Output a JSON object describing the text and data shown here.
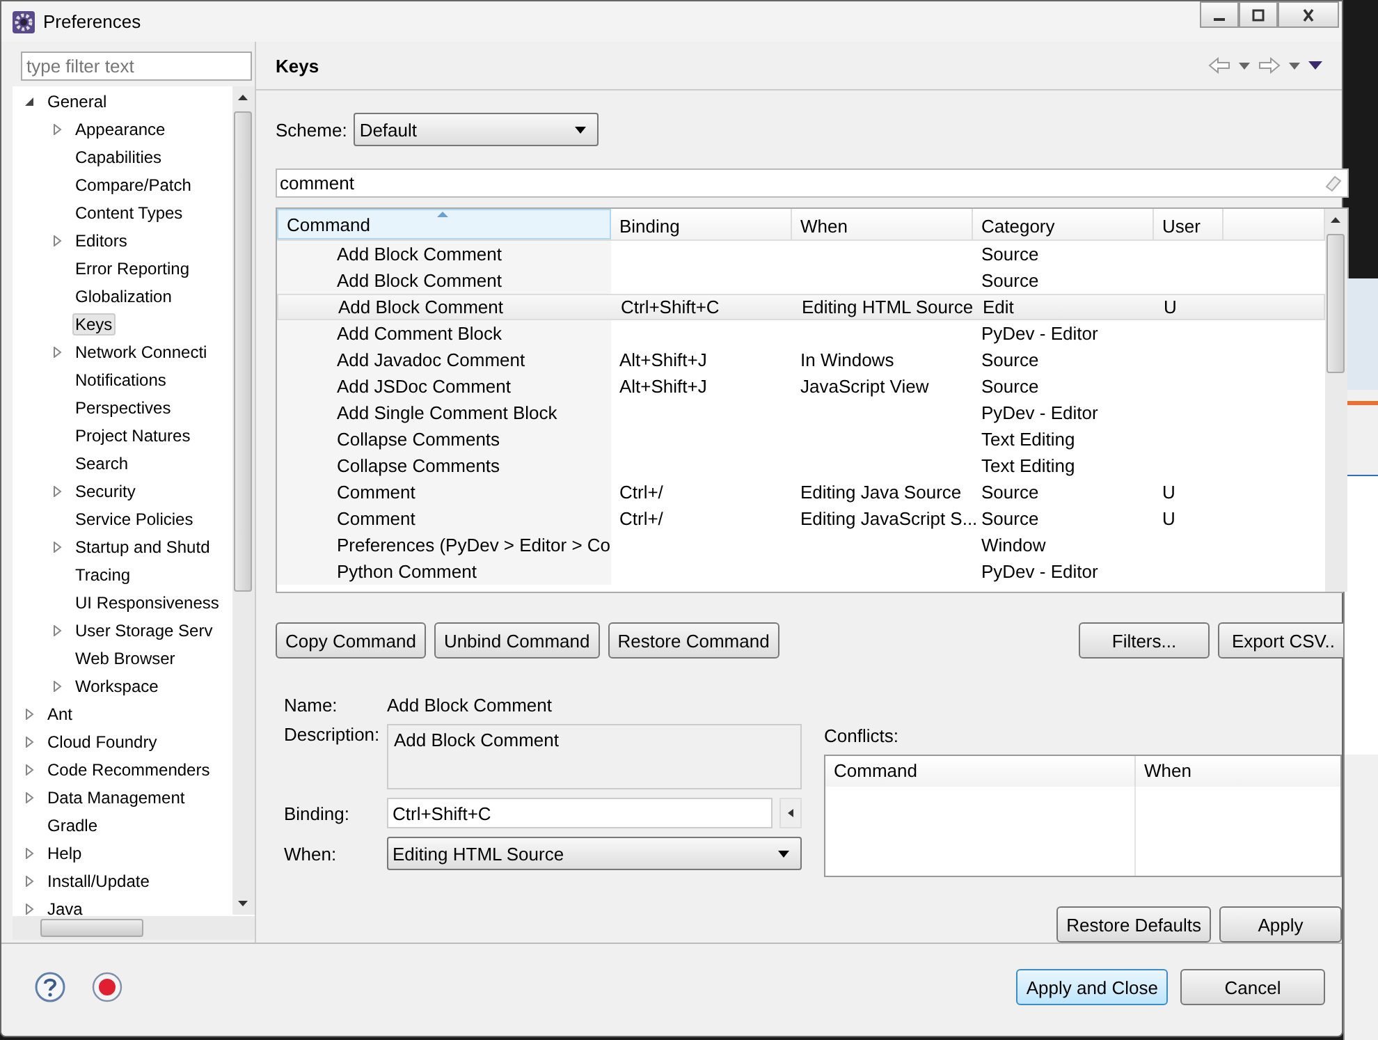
{
  "window": {
    "title": "Preferences"
  },
  "sidebar": {
    "filter": {
      "placeholder": "type filter text"
    },
    "tree": [
      {
        "label": "General",
        "expanded": true,
        "selected": false,
        "children": [
          {
            "label": "Appearance",
            "expanded": false,
            "selected": false
          },
          {
            "label": "Capabilities",
            "selected": false
          },
          {
            "label": "Compare/Patch",
            "selected": false
          },
          {
            "label": "Content Types",
            "selected": false
          },
          {
            "label": "Editors",
            "expanded": false,
            "selected": false
          },
          {
            "label": "Error Reporting",
            "selected": false
          },
          {
            "label": "Globalization",
            "selected": false
          },
          {
            "label": "Keys",
            "selected": true
          },
          {
            "label": "Network Connecti",
            "expanded": false,
            "selected": false
          },
          {
            "label": "Notifications",
            "selected": false
          },
          {
            "label": "Perspectives",
            "selected": false
          },
          {
            "label": "Project Natures",
            "selected": false
          },
          {
            "label": "Search",
            "selected": false
          },
          {
            "label": "Security",
            "expanded": false,
            "selected": false
          },
          {
            "label": "Service Policies",
            "selected": false
          },
          {
            "label": "Startup and Shutd",
            "expanded": false,
            "selected": false
          },
          {
            "label": "Tracing",
            "selected": false
          },
          {
            "label": "UI Responsiveness",
            "selected": false
          },
          {
            "label": "User Storage Serv",
            "expanded": false,
            "selected": false
          },
          {
            "label": "Web Browser",
            "selected": false
          },
          {
            "label": "Workspace",
            "expanded": false,
            "selected": false
          }
        ]
      },
      {
        "label": "Ant",
        "expanded": false,
        "selected": false
      },
      {
        "label": "Cloud Foundry",
        "expanded": false,
        "selected": false
      },
      {
        "label": "Code Recommenders",
        "expanded": false,
        "selected": false
      },
      {
        "label": "Data Management",
        "expanded": false,
        "selected": false
      },
      {
        "label": "Gradle",
        "selected": false
      },
      {
        "label": "Help",
        "expanded": false,
        "selected": false
      },
      {
        "label": "Install/Update",
        "expanded": false,
        "selected": false
      },
      {
        "label": "Java",
        "expanded": false,
        "selected": false
      }
    ]
  },
  "page": {
    "title": "Keys"
  },
  "scheme": {
    "label": "Scheme:",
    "value": "Default"
  },
  "filter": {
    "value": "comment"
  },
  "table": {
    "columns": [
      {
        "label": "Command",
        "sorted": true
      },
      {
        "label": "Binding",
        "sorted": false
      },
      {
        "label": "When",
        "sorted": false
      },
      {
        "label": "Category",
        "sorted": false
      },
      {
        "label": "User",
        "sorted": false
      }
    ],
    "rows": [
      {
        "cells": [
          "Add Block Comment",
          "",
          "",
          "Source",
          ""
        ],
        "selected": false
      },
      {
        "cells": [
          "Add Block Comment",
          "",
          "",
          "Source",
          ""
        ],
        "selected": false
      },
      {
        "cells": [
          "Add Block Comment",
          "Ctrl+Shift+C",
          "Editing HTML Source",
          "Edit",
          "U"
        ],
        "selected": true
      },
      {
        "cells": [
          "Add Comment Block",
          "",
          "",
          "PyDev - Editor",
          ""
        ],
        "selected": false
      },
      {
        "cells": [
          "Add Javadoc Comment",
          "Alt+Shift+J",
          "In Windows",
          "Source",
          ""
        ],
        "selected": false
      },
      {
        "cells": [
          "Add JSDoc Comment",
          "Alt+Shift+J",
          "JavaScript View",
          "Source",
          ""
        ],
        "selected": false
      },
      {
        "cells": [
          "Add Single Comment Block",
          "",
          "",
          "PyDev - Editor",
          ""
        ],
        "selected": false
      },
      {
        "cells": [
          "Collapse Comments",
          "",
          "",
          "Text Editing",
          ""
        ],
        "selected": false
      },
      {
        "cells": [
          "Collapse Comments",
          "",
          "",
          "Text Editing",
          ""
        ],
        "selected": false
      },
      {
        "cells": [
          "Comment",
          "Ctrl+/",
          "Editing Java Source",
          "Source",
          "U"
        ],
        "selected": false
      },
      {
        "cells": [
          "Comment",
          "Ctrl+/",
          "Editing JavaScript S...",
          "Source",
          "U"
        ],
        "selected": false
      },
      {
        "cells": [
          "Preferences (PyDev > Editor > Co",
          "",
          "",
          "Window",
          ""
        ],
        "selected": false
      },
      {
        "cells": [
          "Python Comment",
          "",
          "",
          "PyDev - Editor",
          ""
        ],
        "selected": false
      }
    ]
  },
  "table_buttons": [
    "Copy Command",
    "Unbind Command",
    "Restore Command",
    "Filters...",
    "Export CSV.."
  ],
  "details": {
    "name": {
      "label": "Name:",
      "value": "Add Block Comment"
    },
    "description": {
      "label": "Description:",
      "value": "Add Block Comment"
    },
    "binding": {
      "label": "Binding:",
      "value": "Ctrl+Shift+C"
    },
    "when": {
      "label": "When:",
      "value": "Editing HTML Source"
    }
  },
  "conflicts": {
    "label": "Conflicts:",
    "columns": [
      "Command",
      "When"
    ]
  },
  "page_buttons": [
    "Restore Defaults",
    "Apply"
  ],
  "dialog_buttons": [
    {
      "label": "Apply and Close",
      "default": true
    },
    {
      "label": "Cancel",
      "default": false
    }
  ]
}
